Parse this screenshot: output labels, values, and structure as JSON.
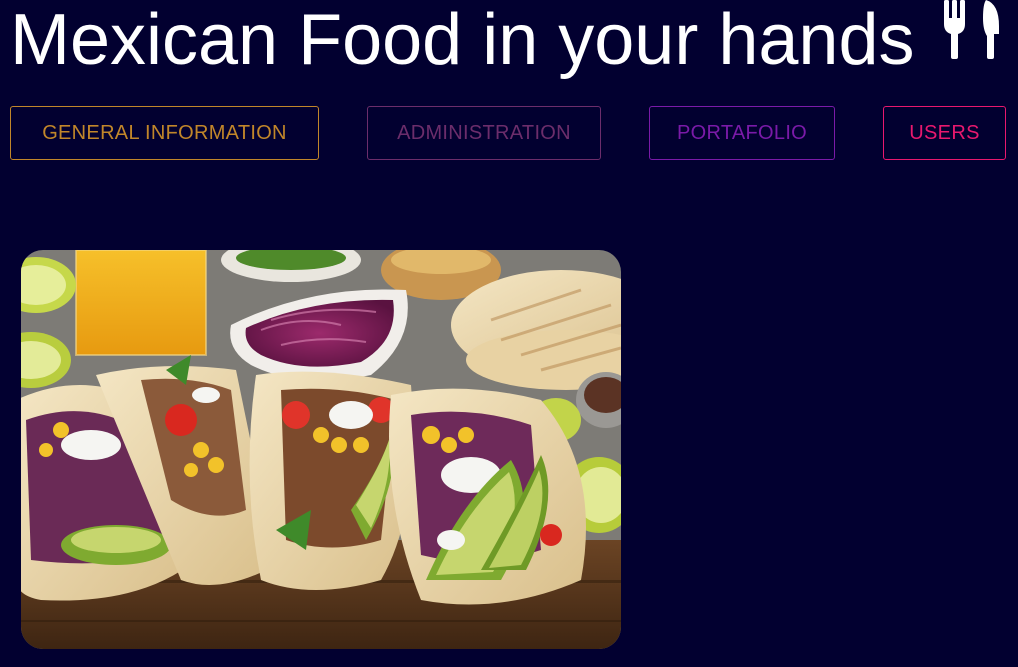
{
  "header": {
    "title": "Mexican Food in your hands",
    "icon": "fork-knife-icon"
  },
  "nav": {
    "buttons": [
      {
        "label": "GENERAL INFORMATION",
        "color": "#c1862a"
      },
      {
        "label": "ADMINISTRATION",
        "color": "#6c2d6b"
      },
      {
        "label": "PORTAFOLIO",
        "color": "#7a1aa8"
      },
      {
        "label": "USERS",
        "color": "#e8186e"
      }
    ]
  },
  "main": {
    "image": {
      "subject": "tacos-photo"
    }
  },
  "colors": {
    "background": "#020030",
    "title": "#ffffff"
  }
}
